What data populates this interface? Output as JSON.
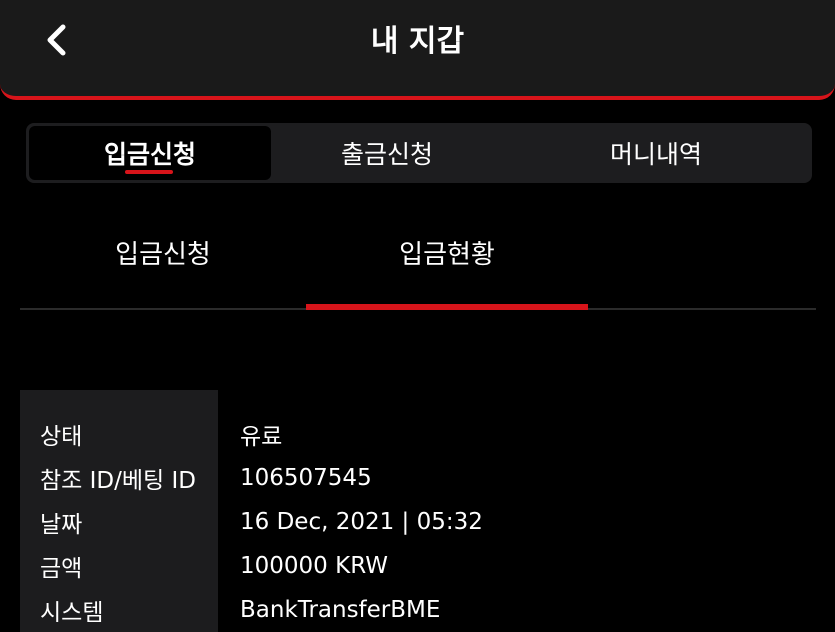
{
  "header": {
    "title": "내 지갑"
  },
  "main_tabs": [
    {
      "label": "입금신청",
      "active": true
    },
    {
      "label": "출금신청",
      "active": false
    },
    {
      "label": "머니내역",
      "active": false
    }
  ],
  "sub_tabs": [
    {
      "label": "입금신청",
      "active": false
    },
    {
      "label": "입금현황",
      "active": true
    }
  ],
  "details": {
    "rows": [
      {
        "label": "상태",
        "value": "유료"
      },
      {
        "label": "참조 ID/베팅 ID",
        "value": "106507545"
      },
      {
        "label": "날짜",
        "value": "16 Dec, 2021 | 05:32"
      },
      {
        "label": "금액",
        "value": "100000 KRW"
      },
      {
        "label": "시스템",
        "value": "BankTransferBME"
      }
    ]
  },
  "colors": {
    "accent": "#d7141a",
    "background": "#000000",
    "header_bg": "#1a1a1a",
    "panel_bg": "#1c1c1e"
  },
  "icons": {
    "back": "chevron-left-icon"
  }
}
